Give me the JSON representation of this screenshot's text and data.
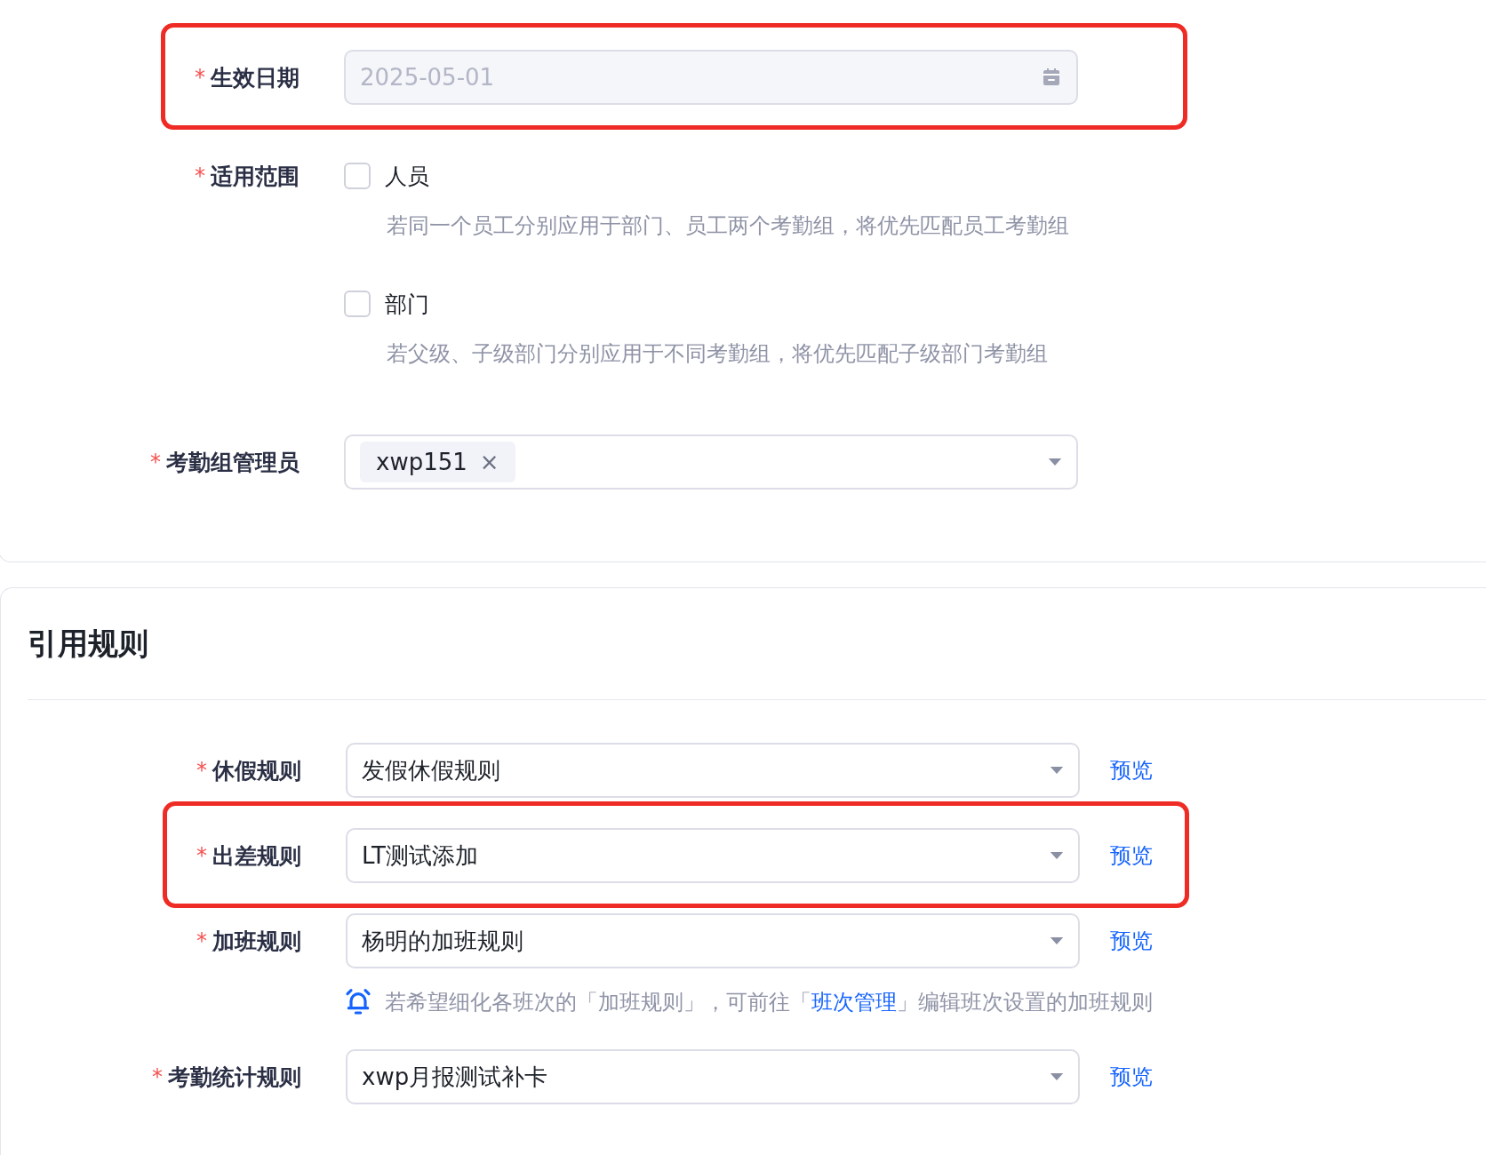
{
  "basic_fields": [
    {
      "kind": "date",
      "required_mark": "*",
      "label": "生效日期",
      "value": "2025-05-01",
      "disabled": true,
      "highlighted": true
    },
    {
      "kind": "checkboxes",
      "required_mark": "*",
      "label": "适用范围",
      "highlighted": false,
      "options": [
        {
          "label": "人员",
          "checked": false,
          "hint": "若同一个员工分别应用于部门、员工两个考勤组，将优先匹配员工考勤组"
        },
        {
          "label": "部门",
          "checked": false,
          "hint": "若父级、子级部门分别应用于不同考勤组，将优先匹配子级部门考勤组"
        }
      ]
    },
    {
      "kind": "tags",
      "required_mark": "*",
      "label": "考勤组管理员",
      "highlighted": false,
      "tags": [
        {
          "text": "xwp151",
          "remove": "×"
        }
      ]
    }
  ],
  "rules_section": {
    "title": "引用规则",
    "fields": [
      {
        "kind": "select",
        "required_mark": "*",
        "label": "休假规则",
        "value": "发假休假规则",
        "link": "预览",
        "highlighted": false
      },
      {
        "kind": "select",
        "required_mark": "*",
        "label": "出差规则",
        "value": "LT测试添加",
        "link": "预览",
        "highlighted": true
      },
      {
        "kind": "select",
        "required_mark": "*",
        "label": "加班规则",
        "value": "杨明的加班规则",
        "link": "预览",
        "highlighted": false,
        "notice": {
          "before": "若希望细化各班次的「加班规则」，可前往「",
          "link": "班次管理",
          "after": "」编辑班次设置的加班规则"
        }
      },
      {
        "kind": "select",
        "required_mark": "*",
        "label": "考勤统计规则",
        "value": "xwp月报测试补卡",
        "link": "预览",
        "highlighted": false
      }
    ]
  }
}
